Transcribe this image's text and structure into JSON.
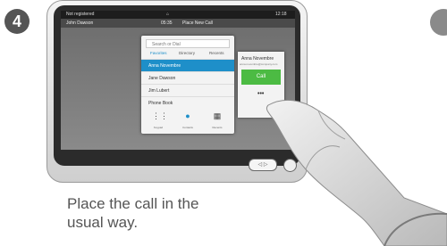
{
  "step_number": "4",
  "statusbar": {
    "left": "Not registered",
    "right": "12:18"
  },
  "subbar": {
    "left": "John Dawson",
    "time": "05:35",
    "action": "Place New Call"
  },
  "dialer": {
    "search_placeholder": "Search or Dial",
    "tabs": [
      "Favorites",
      "Directory",
      "Recents"
    ],
    "rows": [
      "Anna Novembre",
      "Jane Dawson",
      "Jim Lubert",
      "Phone Book"
    ],
    "dock": [
      "Keypad",
      "Contacts",
      "Recents"
    ]
  },
  "callcard": {
    "name": "Anna Novembre",
    "detail": "anna.novembre@company.com",
    "call_label": "Call",
    "more_label": "•••"
  },
  "device_buttons": {
    "pill": "◁ ▷"
  },
  "caption": [
    "Place the call in the",
    "usual way."
  ],
  "colors": {
    "accent": "#1e8fc9",
    "call": "#4cbb43",
    "step_badge": "#555555"
  }
}
